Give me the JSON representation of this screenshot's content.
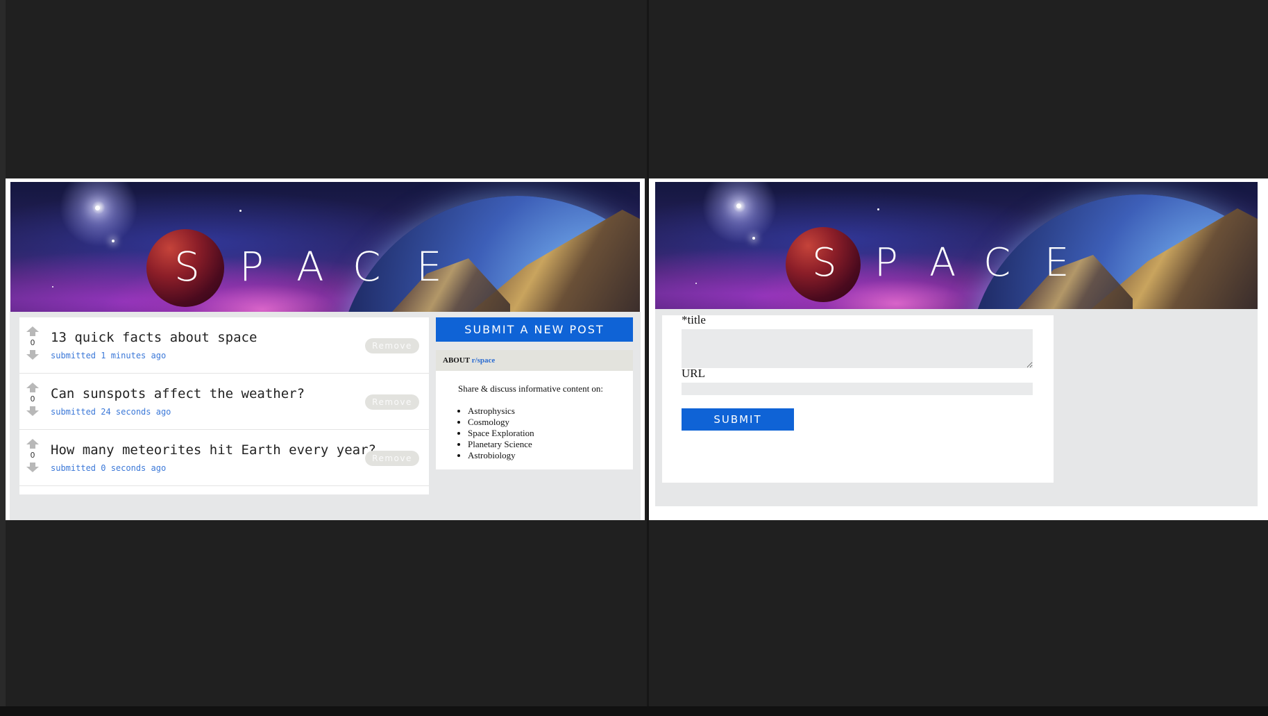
{
  "banner": {
    "letters": [
      "S",
      "P",
      "A",
      "C",
      "E"
    ]
  },
  "posts": [
    {
      "score": "0",
      "title": "13 quick facts about space",
      "meta": "submitted 1 minutes ago",
      "remove_label": "Remove"
    },
    {
      "score": "0",
      "title": "Can sunspots affect the weather?",
      "meta": "submitted 24 seconds ago",
      "remove_label": "Remove"
    },
    {
      "score": "0",
      "title": "How many meteorites hit Earth every year?",
      "meta": "submitted 0 seconds ago",
      "remove_label": "Remove"
    }
  ],
  "sidebar": {
    "submit_label": "SUBMIT A NEW POST",
    "about_prefix": "ABOUT",
    "about_subreddit": "r/space",
    "description": "Share & discuss informative content on:",
    "topics": [
      "Astrophysics",
      "Cosmology",
      "Space Exploration",
      "Planetary Science",
      "Astrobiology"
    ]
  },
  "form": {
    "title_label": "*title",
    "url_label": "URL",
    "title_value": "",
    "url_value": "",
    "submit_label": "SUBMIT"
  },
  "colors": {
    "accent": "#0f63d6",
    "meta_link": "#3b78d8",
    "background": "#202020",
    "panel_gray": "#e6e7e8"
  }
}
